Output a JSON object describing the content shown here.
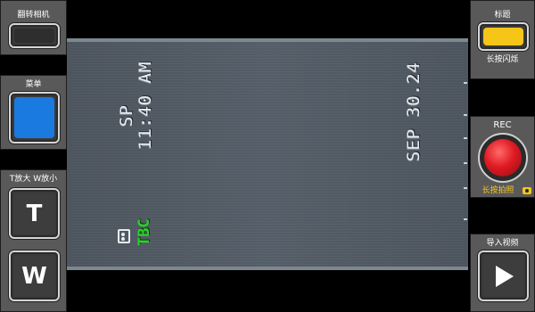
{
  "left_panel": {
    "flip_camera_label": "翻转相机",
    "menu_label": "菜单",
    "zoom_label": "T放大 W放小",
    "tele_button": "T",
    "wide_button": "W"
  },
  "right_panel": {
    "title_label": "标题",
    "title_hint": "长按闪烁",
    "rec_label": "REC",
    "rec_hint": "长按拍照",
    "import_label": "导入视频"
  },
  "osd": {
    "mode": "SP",
    "time": "11:40 AM",
    "date": "SEP 30.24",
    "tbc": "TBC"
  },
  "colors": {
    "title_button": "#f5c518",
    "menu_button": "#1a7ae0",
    "rec_button": "#e01b24",
    "hint_text": "#f5c518",
    "tbc_text": "#2bd12b"
  }
}
